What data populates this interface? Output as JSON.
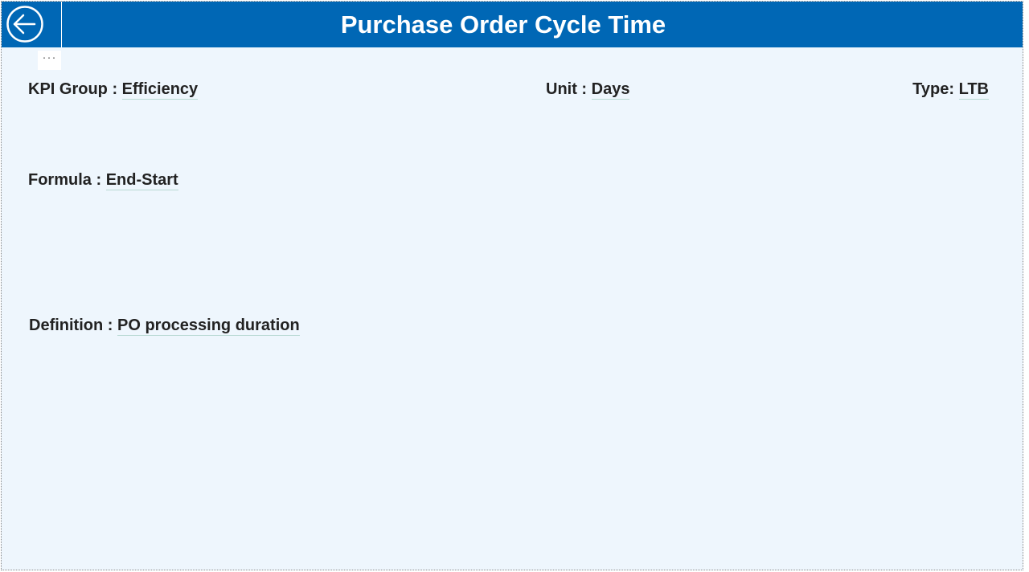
{
  "header": {
    "title": "Purchase Order Cycle Time",
    "back_icon": "arrow-left-circle-icon",
    "background": "#0067b5"
  },
  "more_options_label": "···",
  "fields": {
    "kpi_group": {
      "label": "KPI Group :",
      "value": "Efficiency"
    },
    "unit": {
      "label": "Unit :",
      "value": "Days"
    },
    "type": {
      "label": "Type:",
      "value": "LTB"
    },
    "formula": {
      "label": "Formula :",
      "value": "End-Start"
    },
    "definition": {
      "label": "Definition :",
      "value": "PO processing duration"
    }
  },
  "colors": {
    "page_background": "#eef6fd",
    "header_background": "#0067b5",
    "text": "#222222"
  }
}
